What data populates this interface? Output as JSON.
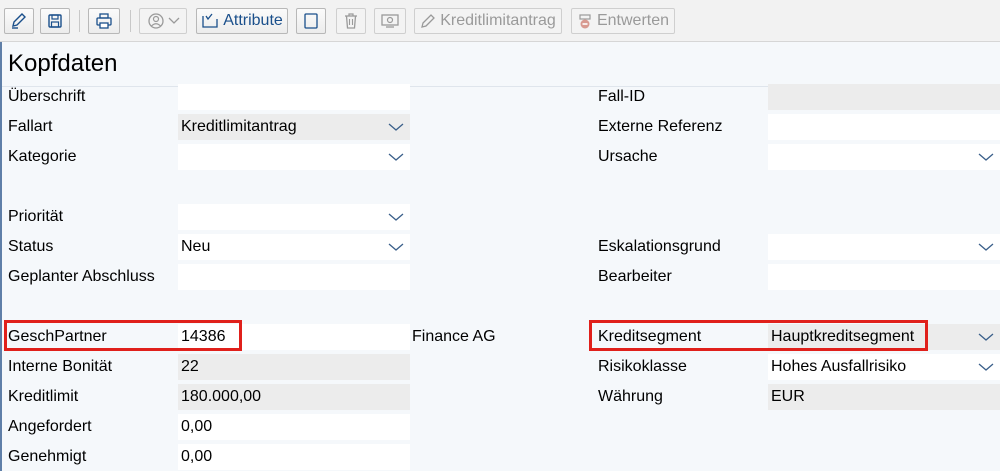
{
  "toolbar": {
    "edit_icon": "edit-pencil-icon",
    "save_icon": "save-disk-icon",
    "print_icon": "printer-icon",
    "user_icon": "user-circle-icon",
    "attribute_label": "Attribute",
    "notes_icon": "document-icon",
    "delete_icon": "trash-icon",
    "screen_icon": "display-icon",
    "kreditlimitantrag_label": "Kreditlimitantrag",
    "entwerten_label": "Entwerten"
  },
  "panel": {
    "title": "Kopfdaten",
    "left_fields": [
      {
        "label": "Überschrift",
        "value": ""
      },
      {
        "label": "Fallart",
        "value": "Kreditlimitantrag"
      },
      {
        "label": "Kategorie",
        "value": ""
      },
      {
        "label": "Priorität",
        "value": ""
      },
      {
        "label": "Status",
        "value": "Neu"
      },
      {
        "label": "Geplanter Abschluss",
        "value": ""
      },
      {
        "label": "GeschPartner",
        "value": "14386"
      },
      {
        "label": "Interne Bonität",
        "value": "22"
      },
      {
        "label": "Kreditlimit",
        "value": "180.000,00"
      },
      {
        "label": "Angefordert",
        "value": "0,00"
      },
      {
        "label": "Genehmigt",
        "value": "0,00"
      }
    ],
    "partner_name": "Finance AG",
    "right_fields": [
      {
        "label": "Fall-ID",
        "value": ""
      },
      {
        "label": "Externe Referenz",
        "value": ""
      },
      {
        "label": "Ursache",
        "value": ""
      },
      {
        "label": "Eskalationsgrund",
        "value": ""
      },
      {
        "label": "Bearbeiter",
        "value": ""
      },
      {
        "label": "Kreditsegment",
        "value": "Hauptkreditsegment"
      },
      {
        "label": "Risikoklasse",
        "value": "Hohes Ausfallrisiko"
      },
      {
        "label": "Währung",
        "value": "EUR"
      }
    ]
  },
  "colors": {
    "highlight": "#e0201b",
    "panel_border": "#5f7fa8",
    "toolbar_blue": "#1a4f8b",
    "readonly_bg": "#ececec"
  }
}
